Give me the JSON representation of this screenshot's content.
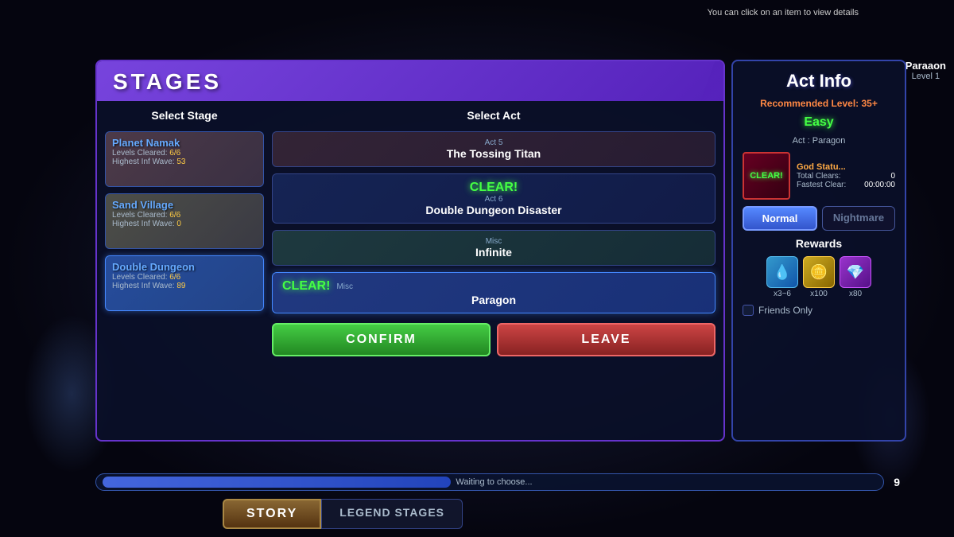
{
  "topHint": "You can click on an item to view details",
  "stagesTitle": "STAGES",
  "selectStageLabel": "Select Stage",
  "selectActLabel": "Select Act",
  "stages": [
    {
      "name": "Planet Namak",
      "levelsCleared": "6/6",
      "highestInfWave": "53",
      "type": "namak",
      "active": false
    },
    {
      "name": "Sand Village",
      "levelsCleared": "6/6",
      "highestInfWave": "0",
      "type": "sand",
      "active": false
    },
    {
      "name": "Double Dungeon",
      "levelsCleared": "6/6",
      "highestInfWave": "89",
      "type": "dungeon",
      "active": true
    }
  ],
  "acts": [
    {
      "actLabel": "Act 5",
      "name": "The Tossing Titan",
      "cleared": false,
      "type": "titan"
    },
    {
      "actLabel": "Act 6",
      "name": "Double Dungeon Disaster",
      "cleared": true,
      "clearText": "CLEAR!",
      "type": "disaster"
    },
    {
      "actLabel": "Misc",
      "name": "Infinite",
      "cleared": false,
      "type": "infinite"
    },
    {
      "actLabel": "Misc",
      "name": "Paragon",
      "cleared": true,
      "clearText": "CLEAR!",
      "type": "paragon",
      "selected": true
    }
  ],
  "confirmButton": "CONFIRM",
  "leaveButton": "LEAVE",
  "actInfo": {
    "title": "Act Info",
    "recommendedLevel": "Recommended Level: 35+",
    "difficulty": "Easy",
    "actName": "Act : Paragon",
    "clearText": "CLEAR!",
    "godStatus": "God Statu...",
    "totalClears": "0",
    "fastestClear": "00:00:00",
    "totalClearsLabel": "Total Clears:",
    "fastestClearLabel": "Fastest Clear:",
    "normalButton": "Normal",
    "nightmareButton": "Nightmare",
    "rewardsTitle": "Rewards",
    "rewards": [
      {
        "type": "water",
        "icon": "💧",
        "count": "x3~6"
      },
      {
        "type": "gold",
        "icon": "🪙",
        "count": "x100"
      },
      {
        "type": "gem",
        "icon": "💎",
        "count": "x80"
      }
    ],
    "friendsOnly": "Friends Only"
  },
  "playerInfo": {
    "name": "Paraaon",
    "level": "Level 1"
  },
  "bottomBar": {
    "waitingText": "Waiting to choose...",
    "number": "9"
  },
  "tabs": {
    "story": "STORY",
    "legend": "LEGEND STAGES"
  }
}
